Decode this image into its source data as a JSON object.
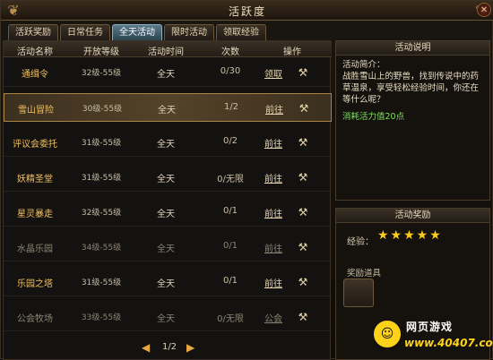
{
  "window": {
    "title": "活跃度",
    "close_glyph": "✕",
    "ornament_glyph": "❦"
  },
  "tabs": [
    {
      "label": "活跃奖励",
      "active": false
    },
    {
      "label": "日常任务",
      "active": false
    },
    {
      "label": "全天活动",
      "active": true
    },
    {
      "label": "限时活动",
      "active": false
    },
    {
      "label": "领取经验",
      "active": false
    }
  ],
  "table": {
    "headers": [
      "活动名称",
      "开放等级",
      "活动时间",
      "次数",
      "操作"
    ],
    "rows": [
      {
        "name": "通缉令",
        "level": "32级-55级",
        "time": "全天",
        "count": "0/30",
        "action": "领取",
        "icon": "wrench-icon",
        "dim": false,
        "selected": false
      },
      {
        "name": "雪山冒险",
        "level": "30级-55级",
        "time": "全天",
        "count": "1/2",
        "action": "前往",
        "icon": "wrench-icon",
        "dim": false,
        "selected": true
      },
      {
        "name": "评议会委托",
        "level": "31级-55级",
        "time": "全天",
        "count": "0/2",
        "action": "前往",
        "icon": "wrench-icon",
        "dim": false,
        "selected": false
      },
      {
        "name": "妖精圣堂",
        "level": "31级-55级",
        "time": "全天",
        "count": "0/无限",
        "action": "前往",
        "icon": "wrench-icon",
        "dim": false,
        "selected": false
      },
      {
        "name": "星灵暴走",
        "level": "32级-55级",
        "time": "全天",
        "count": "0/1",
        "action": "前往",
        "icon": "wrench-icon",
        "dim": false,
        "selected": false
      },
      {
        "name": "水晶乐园",
        "level": "34级-55级",
        "time": "全天",
        "count": "0/1",
        "action": "前往",
        "icon": "wrench-icon",
        "dim": true,
        "selected": false
      },
      {
        "name": "乐园之塔",
        "level": "31级-55级",
        "time": "全天",
        "count": "0/1",
        "action": "前往",
        "icon": "wrench-icon",
        "dim": false,
        "selected": false
      },
      {
        "name": "公会牧场",
        "level": "33级-55级",
        "time": "全天",
        "count": "0/无限",
        "action": "公会",
        "icon": "wrench-icon",
        "dim": true,
        "selected": false
      }
    ]
  },
  "pager": {
    "text": "1/2",
    "prev_glyph": "◀",
    "next_glyph": "▶"
  },
  "description": {
    "header": "活动说明",
    "intro": "活动简介：",
    "body": "战胜雪山上的野兽，找到传说中的药草温泉，享受轻松经验时间，你还在等什么呢？",
    "cost": "消耗活力值20点"
  },
  "reward": {
    "header": "活动奖励",
    "exp_label": "经验：",
    "exp_stars": 5,
    "stars_text": "★★★★★",
    "item_label": "奖励道具"
  },
  "watermark": {
    "title": "网页游戏",
    "url": "www.40407.com",
    "face": "☺"
  },
  "colors": {
    "accent": "#f0c060",
    "active_tab": "#5a7a8a",
    "cost_green": "#7ce25a",
    "star": "#ffcc1a"
  }
}
